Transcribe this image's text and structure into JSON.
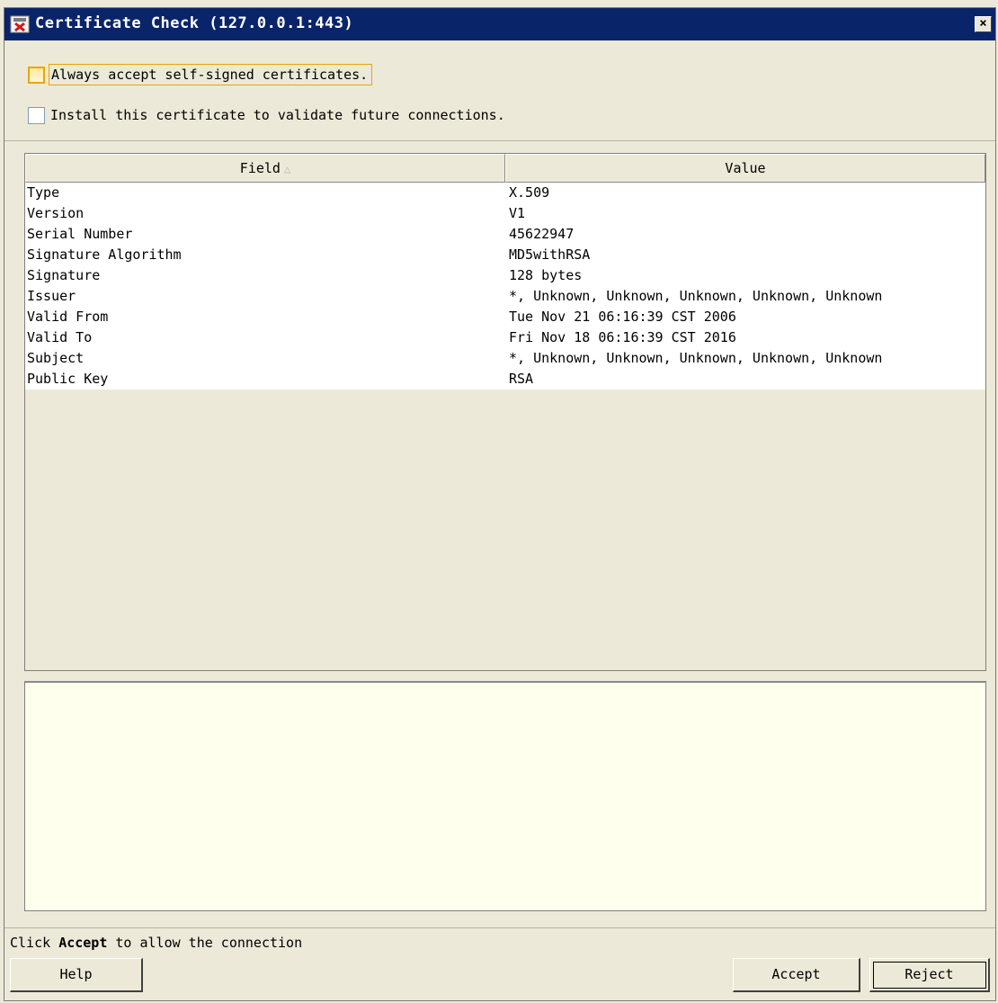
{
  "window": {
    "title": "Certificate Check (127.0.0.1:443)",
    "close_label": "×"
  },
  "options": {
    "always_accept": {
      "label": "Always accept self-signed certificates.",
      "checked": false
    },
    "install_cert": {
      "label": "Install this certificate to validate future connections.",
      "checked": false
    }
  },
  "table": {
    "columns": {
      "field": "Field",
      "value": "Value",
      "sort_icon": "△"
    },
    "rows": [
      {
        "field": "Type",
        "value": "X.509"
      },
      {
        "field": "Version",
        "value": "V1"
      },
      {
        "field": "Serial Number",
        "value": "45622947"
      },
      {
        "field": "Signature Algorithm",
        "value": "MD5withRSA"
      },
      {
        "field": "Signature",
        "value": "128 bytes"
      },
      {
        "field": "Issuer",
        "value": "*, Unknown, Unknown, Unknown, Unknown, Unknown"
      },
      {
        "field": "Valid From",
        "value": "Tue Nov 21 06:16:39 CST 2006"
      },
      {
        "field": "Valid To",
        "value": "Fri Nov 18 06:16:39 CST 2016"
      },
      {
        "field": "Subject",
        "value": "*, Unknown, Unknown, Unknown, Unknown, Unknown"
      },
      {
        "field": "Public Key",
        "value": "RSA"
      }
    ]
  },
  "status": {
    "prefix": "Click ",
    "bold": "Accept",
    "suffix": " to allow the connection"
  },
  "buttons": {
    "help": "Help",
    "accept": "Accept",
    "reject": "Reject"
  },
  "colors": {
    "titlebar": "#0a246a",
    "window_bg": "#ece9d8",
    "detail_bg": "#ffffee",
    "focus_accent": "#e8a600"
  }
}
